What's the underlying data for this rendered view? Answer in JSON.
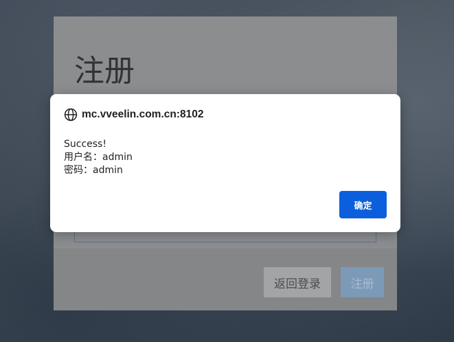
{
  "background_panel": {
    "title": "注册",
    "back_button_label": "返回登录",
    "register_button_label": "注册"
  },
  "alert_dialog": {
    "origin": "mc.vveelin.com.cn:8102",
    "origin_icon": "globe-icon",
    "message_lines": [
      "Success!",
      "用户名：admin",
      "密码：admin"
    ],
    "ok_button_label": "确定"
  },
  "colors": {
    "dialog_button": "#0b5fdc",
    "dialog_background": "#ffffff",
    "register_button_dimmed": "#7c9ab8"
  }
}
